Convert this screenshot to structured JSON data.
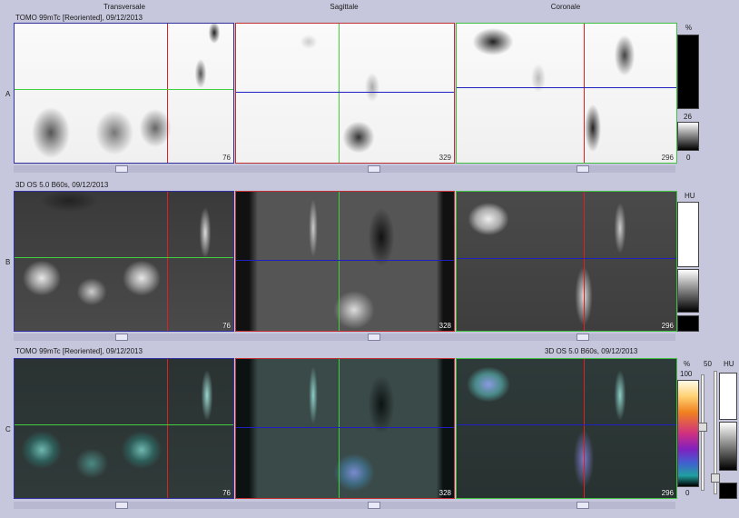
{
  "columns": [
    "Transversale",
    "Sagittale",
    "Coronale"
  ],
  "rows": [
    {
      "letter": "A",
      "title": "TOMO 99mTc [Reoriented], 09/12/2013",
      "slices": [
        "76",
        "329",
        "296"
      ]
    },
    {
      "letter": "B",
      "title": "3D  OS  5.0  B60s, 09/12/2013",
      "slices": [
        "76",
        "328",
        "296"
      ]
    },
    {
      "letter": "C",
      "title": "TOMO 99mTc [Reoriented], 09/12/2013",
      "title_right": "3D  OS  5.0  B60s, 09/12/2013",
      "slices": [
        "76",
        "328",
        "296"
      ]
    }
  ],
  "scales": {
    "a": {
      "unit": "%",
      "max": "26",
      "min": "0"
    },
    "b": {
      "unit": "HU"
    },
    "c": {
      "unit_left": "%",
      "max": "100",
      "min": "0",
      "window": "50",
      "unit_right": "HU"
    }
  },
  "colors": {
    "transversal_vline": "#e02020",
    "transversal_hline": "#40d040",
    "sagittal_vline": "#40d040",
    "sagittal_hline": "#2020c0",
    "coronal_vline": "#e02020",
    "coronal_hline": "#2020c0",
    "frame_transversal": "#3030a0",
    "frame_sagittal": "#c03030",
    "frame_coronal": "#40c040"
  }
}
